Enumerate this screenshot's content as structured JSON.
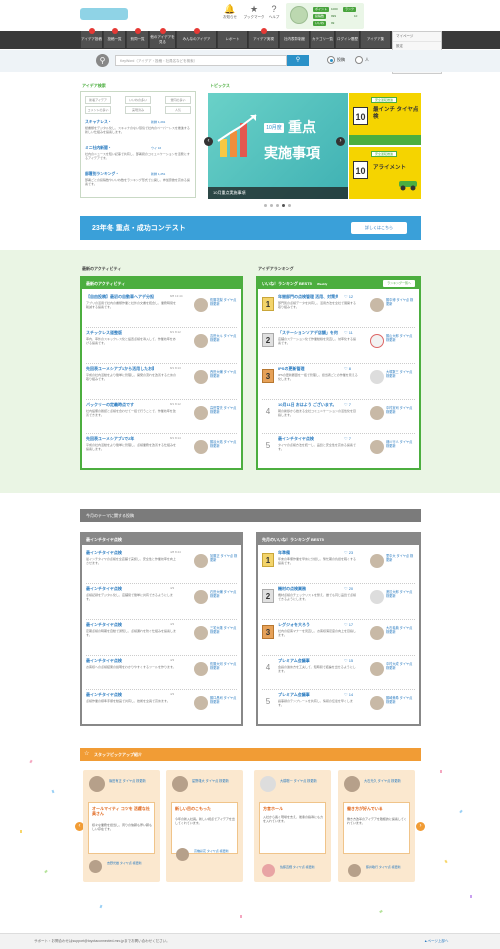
{
  "header": {
    "logo_text": "",
    "icons": [
      {
        "name": "bell-icon",
        "label": "お知らせ"
      },
      {
        "name": "bookmark-icon",
        "label": "ブックマーク"
      },
      {
        "name": "help-icon",
        "label": "ヘルプ"
      }
    ],
    "user": {
      "stats": [
        {
          "label": "ポイント",
          "value": "1000"
        },
        {
          "label": "投稿数",
          "value": "999"
        },
        {
          "label": "いいね",
          "value": "99"
        },
        {
          "label": "ランク",
          "value": "10"
        }
      ]
    }
  },
  "nav": {
    "items": [
      "アイデア投稿",
      "投稿一覧",
      "賛同一覧",
      "他のアイデアを見る",
      "みんなのアイデア",
      "レポート",
      "アイデア実現",
      "社内表彰制度",
      "カテゴリ一覧",
      "ログイン履歴",
      "アイデア集"
    ],
    "dropdown_items": [
      "マイページ",
      "設定",
      "ログアウト",
      "新しく参加された方へ"
    ],
    "active_item": "アイデア集"
  },
  "search": {
    "placeholder": "KeyWord（アイデア・投稿・社員名などを検索）",
    "button_icon": "search-icon",
    "radio_options": [
      "投稿",
      "人"
    ]
  },
  "left_section": {
    "title": "アイデア検索",
    "tabs": [
      "新着アイデア",
      "いいねの多い",
      "賛同の多い",
      "コメントの多い",
      "実現済み",
      "人気"
    ],
    "items": [
      {
        "title": "スキャナレス・",
        "meta": "新鮮 1,291",
        "desc": "紙書類をデジタル化し、スキャナのない環境で社内のペーパーレスを推進する新しい仕組みを提案します。"
      },
      {
        "title": "ミニ社内新聞・",
        "meta": "ウイ 16",
        "desc": "社内のニュースを短い記事で共有し、部署間のコミュニケーションを活発にするアイデアです。"
      },
      {
        "title": "部署別ランキング・",
        "meta": "新鮮 1,251",
        "desc": "部署ごとの投稿数やいいね数をランキング形式で公開し、参加意欲を高める提案です。"
      }
    ]
  },
  "topics": {
    "title": "トピックス",
    "main_banner": {
      "year_label": "10月度",
      "heading_1": "重点",
      "heading_2": "実施事項",
      "caption": "10月重点実施事項"
    },
    "side_banners": [
      {
        "tag": "安全運転推進",
        "number": "10",
        "text": "最インチ タイヤ点検",
        "color": "#f5d400"
      },
      {
        "tag": "安全運転推進",
        "number": "10",
        "text": "アライメント",
        "color": "#f5d400"
      }
    ],
    "dots": 5,
    "active_dot": 4
  },
  "contest": {
    "title": "23年冬 重点・成功コンテスト",
    "button": "詳しくはこちら"
  },
  "activity": {
    "section_title": "最新のアクティビティ",
    "panel_title": "最新のアクティビティ",
    "rows": [
      {
        "title": "【自由投稿】最初の自動車ヘアデ分担",
        "time": "8/8 13:44",
        "desc": "アブリの活用で社内の書類作業と社外の文書を統合し、業務時間を削減する提案です。",
        "user": "佐藤花梨 タイヤ点 検更新"
      },
      {
        "title": "スチックレス道整版",
        "time": "8/1 8:12",
        "desc": "車内、車外のスキックレス化と設置点検を導入して、作業効率をあげる提案です。",
        "user": "吉田大斗 タイヤ点 検更新"
      },
      {
        "title": "先回表ユーメシアブ1から活用したお財議論",
        "time": "8/1 8:13",
        "desc": "平成の社内活動をより簡単に管理し、開発の流れを改善するための取り組みです。",
        "user": "西田大輔 タイヤ点 検更新"
      },
      {
        "title": "バックリーの定義時点です",
        "time": "8/1 8:12",
        "desc": "社内設備の確認と点検を合わせて一括で行うことで、作業効率を改善できます。",
        "user": "高田雪夫 タイヤ点 検更新"
      },
      {
        "title": "先回表ユーメシアブ1で2年",
        "time": "8/1 8:14",
        "desc": "平成の社内活動をより簡単に管理し、点検業務を改善する仕組みを提案します。",
        "user": "藤谷大祐 タイヤ点 検更新"
      }
    ]
  },
  "ranking": {
    "section_title": "アイデアランキング",
    "panel_title": "いいね！ランキング BEST5",
    "panel_sub": "Weekly",
    "panel_button": "ランキング一覧へ",
    "rows": [
      {
        "rank": "1",
        "title": "年間部門の点検管理 活用、対策共有、",
        "likes": "♡ 12",
        "desc": "部門別の点検データを共有し、活用方法を全社で展開する取り組みです。",
        "user": "藤中博 タイヤ点 検更新"
      },
      {
        "rank": "2",
        "title": "「ステーションソアデ店舗」を何か",
        "likes": "♡ 11",
        "desc": "店舗のステーション化で作業動線を見直し、効率化する提案です。",
        "user": "藤山大郎 タイヤ点 検更新"
      },
      {
        "rank": "3",
        "title": "IPSの更新管理",
        "likes": "♡ 8",
        "desc": "IPSの更新履歴を一括で管理し、担当者ごとの作業を見える化します。",
        "user": "大塚数三 タイヤ点 検更新"
      },
      {
        "rank": "4",
        "title": "10月11日 おはよう ございます。",
        "likes": "♡ 7",
        "desc": "朝の挨拶から始まる全社コミュニケーションの活性化を目指します。",
        "user": "中村憲司 タイヤ点 検更新"
      },
      {
        "rank": "5",
        "title": "最インチタイヤ点検",
        "likes": "♡ 7",
        "desc": "タイヤの点検方法を統一し、品質と安全性を高める提案です。",
        "user": "畑川行人 タイヤ点 検更新"
      }
    ]
  },
  "theme_section": {
    "title": "今月のテーマに関する投稿",
    "left_panel_title": "最インチタイヤ点検",
    "left_rows": [
      {
        "title": "最インチタイヤ点検",
        "time": "4/8 8:44",
        "desc": "最インチタイヤの点検を全店舗で実施し、安全性と作業効率を向上させます。",
        "user": "加藤正 タイヤ点 検更新"
      },
      {
        "title": "最インチタイヤ点検",
        "time": "4/3",
        "desc": "点検記録をデジタル化し、店舗間で簡単に共有できるようにします。",
        "user": "石田大輔 タイヤ点 検更新"
      },
      {
        "title": "最インチタイヤ点検",
        "time": "4/3",
        "desc": "定期点検の時期を自動で通知し、点検漏れを防ぐ仕組みを提案します。",
        "user": "三宅大雄 タイヤ点 検更新"
      },
      {
        "title": "最インチタイヤ点検",
        "time": "4/3",
        "desc": "お客様への点検結果の説明をわかりやすくするツールを作ります。",
        "user": "佐藤大河 タイヤ点 検更新"
      },
      {
        "title": "最インチタイヤ点検",
        "time": "4/3",
        "desc": "点検作業の標準手順を動画で共有し、技術を全員で高めます。",
        "user": "藤口昌司 タイヤ点 検更新"
      }
    ],
    "right_panel_title": "先月のいいね！ランキング BEST5",
    "right_rows": [
      {
        "rank": "1",
        "title": "年準備",
        "likes": "♡ 23",
        "desc": "年末の準備作業を早めに分担し、繁忙期の負担を軽くする提案です。",
        "user": "里中大 タイヤ点 検更新"
      },
      {
        "rank": "2",
        "title": "機材の点検業務",
        "likes": "♡ 20",
        "desc": "機材点検のチェックリストを整え、誰でも同じ品質で点検できるようにします。",
        "user": "渡辺大郎 タイヤ点 検更新"
      },
      {
        "rank": "3",
        "title": "レグジォを大ろう",
        "likes": "♡ 17",
        "desc": "社内の接客マナーを見直し、お客様満足度の向上を目指します。",
        "user": "大石義典 タイヤ点 検更新"
      },
      {
        "rank": "4",
        "title": "プレミアム会議事",
        "likes": "♡ 15",
        "desc": "会議の進め方を工夫して、短時間で結論を出せるようにします。",
        "user": "中村大成 タイヤ点 検更新"
      },
      {
        "rank": "5",
        "title": "プレミアム会議事",
        "likes": "♡ 14",
        "desc": "議事録のテンプレートを共有し、情報の伝達を早くします。",
        "user": "藤崎美希 タイヤ点 検更新"
      }
    ]
  },
  "staff": {
    "title": "スタッフピックアップ紹介",
    "cards": [
      {
        "user_top": "篠田有正 タイヤ点 検更新",
        "heading": "オールマイティ コツを 活躍な社員さん",
        "body": "様々な業務を担当し、周りの信頼も厚い頼もしい存在です。",
        "user_bottom": "吉野光雄 タイヤ点 検更新"
      },
      {
        "user_top": "星野雄大 タイヤ点 検更新",
        "heading": "新しい目のこもった",
        "body": "今年の新入社員。新しい視点でアイデアを出してくれています。",
        "user_bottom": "高橋彩花 タイヤ点 検更新"
      },
      {
        "user_top": "大橋聡一 タイヤ点 検更新",
        "heading": "方言ホール",
        "body": "入社から長く現場を支え、後輩の指導にも力を入れています。",
        "user_bottom": "佐藤直輝 タイヤ点 検更新"
      },
      {
        "user_top": "大石光久 タイヤ点 検更新",
        "heading": "働き方が好んでいる",
        "body": "働き方改革のアイデアを積極的に提案してくれています。",
        "user_bottom": "藤井敏行 タイヤ点 検更新"
      }
    ]
  },
  "footer": {
    "text": "サポート・お問合わせはsupport@toyotaconnected-mrc.jpまでお問い合わせください。",
    "link": "▲ページ上部へ"
  },
  "colors": {
    "green": "#4cae3f",
    "blue": "#3aa0d9",
    "orange": "#f19c35",
    "dark_nav": "#3a3a3a"
  }
}
